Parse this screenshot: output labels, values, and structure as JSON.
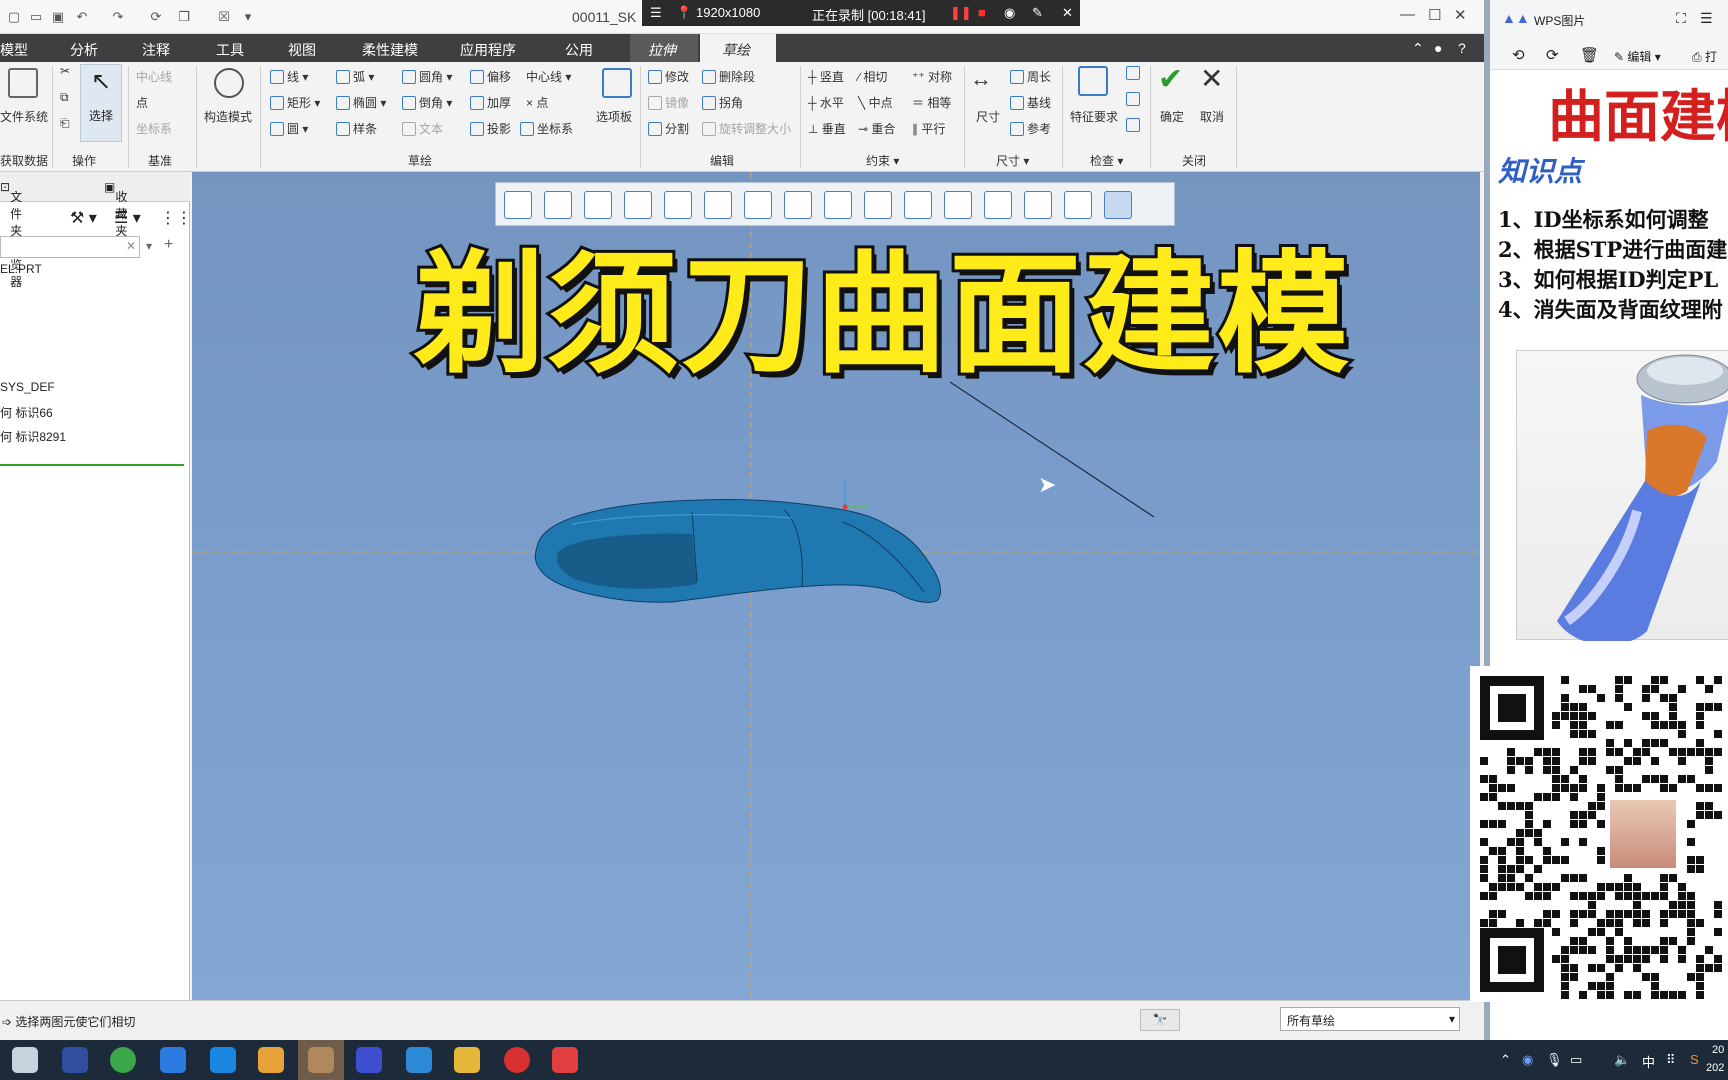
{
  "window": {
    "title": "00011_SK"
  },
  "recorder": {
    "resolution": "1920x1080",
    "status": "正在录制 [00:18:41]"
  },
  "menu": {
    "tabs": [
      "模型",
      "分析",
      "注释",
      "工具",
      "视图",
      "柔性建模",
      "应用程序",
      "公用",
      "拉伸",
      "草绘"
    ]
  },
  "ribbon": {
    "get_data": {
      "label": "文件系统",
      "group": "获取数据"
    },
    "operations": {
      "select": "选择",
      "group": "操作"
    },
    "datum": {
      "centerline": "中心线",
      "point": "点",
      "csys": "坐标系",
      "group": "基准"
    },
    "construct_mode": "构造模式",
    "sketch": {
      "line": "线",
      "arc": "弧",
      "fillet": "圆角",
      "offset": "偏移",
      "centerline": "中心线",
      "rect": "矩形",
      "ellipse": "椭圆",
      "chamfer": "倒角",
      "thicken": "加厚",
      "point": "点",
      "circle": "圆",
      "spline": "样条",
      "text": "文本",
      "project": "投影",
      "csys": "坐标系",
      "palette": "选项板",
      "group": "草绘"
    },
    "edit": {
      "modify": "修改",
      "delete_seg": "删除段",
      "mirror": "镜像",
      "corner": "拐角",
      "divide": "分割",
      "rotate_resize": "旋转调整大小",
      "group": "编辑"
    },
    "constrain": {
      "vertical": "竖直",
      "tangent": "相切",
      "symmetric": "对称",
      "horizontal": "水平",
      "midpoint": "中点",
      "equal": "相等",
      "perpendicular": "垂直",
      "coincident": "重合",
      "parallel": "平行",
      "group": "约束"
    },
    "dimension": {
      "dimension": "尺寸",
      "perimeter": "周长",
      "baseline": "基线",
      "reference": "参考",
      "group": "尺寸"
    },
    "inspect": {
      "feature_req": "特征要求",
      "group": "检查"
    },
    "close": {
      "ok": "确定",
      "cancel": "取消",
      "group": "关闭"
    }
  },
  "sidebar": {
    "tabs": [
      "文件夹浏览器",
      "收藏夹"
    ],
    "tree": [
      "EL.PRT",
      "SYS_DEF",
      "何 标识66",
      "何 标识8291"
    ]
  },
  "overlay_title": "剃须刀曲面建模",
  "status": {
    "message": "选择两图元使它们相切",
    "filter": "所有草绘"
  },
  "wps": {
    "app_title": "WPS图片",
    "edit_label": "编辑",
    "print_label": "打",
    "headline": "曲面建模",
    "knowledge_label": "知识点",
    "points": [
      "1、ID坐标系如何调整",
      "2、根据STP进行曲面建",
      "3、如何根据ID判定PL",
      "4、消失面及背面纹理附"
    ]
  },
  "taskbar": {
    "ime": "中",
    "clock_frag1": "20",
    "clock_frag2": "202"
  },
  "colors": {
    "viewport": "#7a9ccb",
    "title_yellow": "#ffeb1a",
    "wps_red": "#d41f1f",
    "menubar": "#3f3f41",
    "model_blue": "#1f78b0"
  }
}
